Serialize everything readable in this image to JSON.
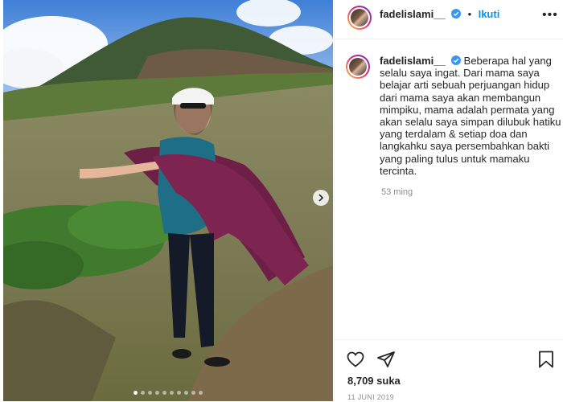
{
  "post": {
    "username": "fadelislami__",
    "verified": true,
    "follow_label": "Ikuti",
    "bullet": "•",
    "more_label": "•••",
    "caption": "Beberapa hal yang selalu saya ingat. Dari mama saya belajar arti sebuah perjuangan hidup dari mama saya akan membangun mimpiku, mama adalah permata yang akan selalu saya simpan dilubuk hatiku yang terdalam & setiap doa dan langkahku saya persembahkan bakti yang paling tulus untuk mamaku tercinta.",
    "time_ago": "53 ming",
    "likes": "8,709 suka",
    "date": "11 JUNI 2019"
  },
  "carousel": {
    "total": 10,
    "current": 1
  },
  "colors": {
    "accent": "#0095f6",
    "verified": "#3897f0",
    "muted": "#8e8e8e",
    "text": "#262626"
  },
  "icons": [
    "verified-icon",
    "more-options-icon",
    "heart-icon",
    "share-icon",
    "bookmark-icon",
    "chevron-right-icon"
  ]
}
